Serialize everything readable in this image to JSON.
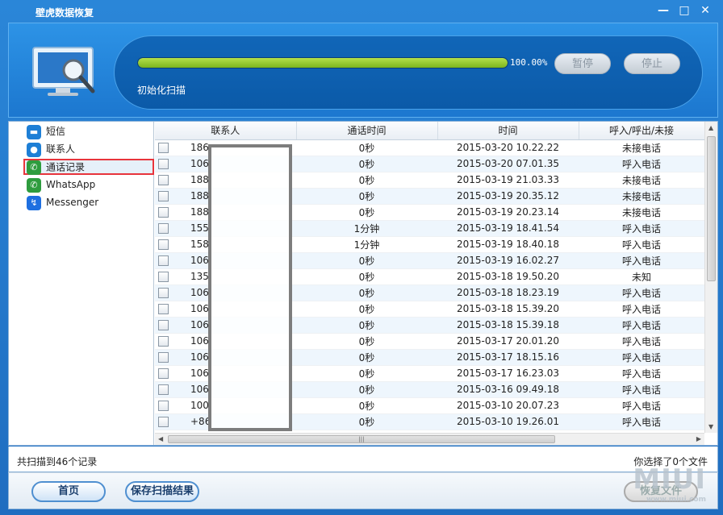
{
  "window": {
    "title": "壁虎数据恢复",
    "minimize": "—",
    "maximize": "□",
    "close": "✕"
  },
  "scan": {
    "progress_percent": 100,
    "progress_label": "100.00%",
    "pause_label": "暂停",
    "stop_label": "停止",
    "status": "初始化扫描"
  },
  "sidebar": {
    "items": [
      {
        "label": "短信",
        "icon": "sms-icon",
        "color": "#1e7fd6",
        "glyph": "▬"
      },
      {
        "label": "联系人",
        "icon": "contact-icon",
        "color": "#1e7fd6",
        "glyph": "●"
      },
      {
        "label": "通话记录",
        "icon": "phone-icon",
        "color": "#2e9c3e",
        "glyph": "✆"
      },
      {
        "label": "WhatsApp",
        "icon": "whatsapp-icon",
        "color": "#2e9c3e",
        "glyph": "✆"
      },
      {
        "label": "Messenger",
        "icon": "messenger-icon",
        "color": "#1e6fe0",
        "glyph": "↯"
      }
    ],
    "active_index": 2
  },
  "table": {
    "columns": [
      "联系人",
      "通话时间",
      "时间",
      "呼入/呼出/未接"
    ],
    "rows": [
      {
        "contact": "186",
        "duration": "0秒",
        "time": "2015-03-20 10.22.22",
        "type": "未接电话"
      },
      {
        "contact": "106",
        "duration": "0秒",
        "time": "2015-03-20 07.01.35",
        "type": "呼入电话"
      },
      {
        "contact": "188",
        "duration": "0秒",
        "time": "2015-03-19 21.03.33",
        "type": "未接电话"
      },
      {
        "contact": "188",
        "duration": "0秒",
        "time": "2015-03-19 20.35.12",
        "type": "未接电话"
      },
      {
        "contact": "188",
        "duration": "0秒",
        "time": "2015-03-19 20.23.14",
        "type": "未接电话"
      },
      {
        "contact": "155",
        "duration": "1分钟",
        "time": "2015-03-19 18.41.54",
        "type": "呼入电话"
      },
      {
        "contact": "158",
        "duration": "1分钟",
        "time": "2015-03-19 18.40.18",
        "type": "呼入电话"
      },
      {
        "contact": "106",
        "duration": "0秒",
        "time": "2015-03-19 16.02.27",
        "type": "呼入电话"
      },
      {
        "contact": "135",
        "duration": "0秒",
        "time": "2015-03-18 19.50.20",
        "type": "未知"
      },
      {
        "contact": "106",
        "duration": "0秒",
        "time": "2015-03-18 18.23.19",
        "type": "呼入电话"
      },
      {
        "contact": "106",
        "duration": "0秒",
        "time": "2015-03-18 15.39.20",
        "type": "呼入电话"
      },
      {
        "contact": "106",
        "duration": "0秒",
        "time": "2015-03-18 15.39.18",
        "type": "呼入电话"
      },
      {
        "contact": "106",
        "duration": "0秒",
        "time": "2015-03-17 20.01.20",
        "type": "呼入电话"
      },
      {
        "contact": "106",
        "duration": "0秒",
        "time": "2015-03-17 18.15.16",
        "type": "呼入电话"
      },
      {
        "contact": "106",
        "duration": "0秒",
        "time": "2015-03-17 16.23.03",
        "type": "呼入电话"
      },
      {
        "contact": "106",
        "duration": "0秒",
        "time": "2015-03-16 09.49.18",
        "type": "呼入电话"
      },
      {
        "contact": "100",
        "duration": "0秒",
        "time": "2015-03-10 20.07.23",
        "type": "呼入电话"
      },
      {
        "contact": "+86",
        "duration": "0秒",
        "time": "2015-03-10 19.26.01",
        "type": "呼入电话"
      }
    ]
  },
  "status_bar": {
    "scanned": "共扫描到46个记录",
    "selected": "你选择了0个文件"
  },
  "buttons": {
    "home": "首页",
    "save": "保存扫描结果",
    "recover": "恢复文件"
  },
  "watermark": {
    "text": "MIUI",
    "sub": "www.miui.com"
  }
}
